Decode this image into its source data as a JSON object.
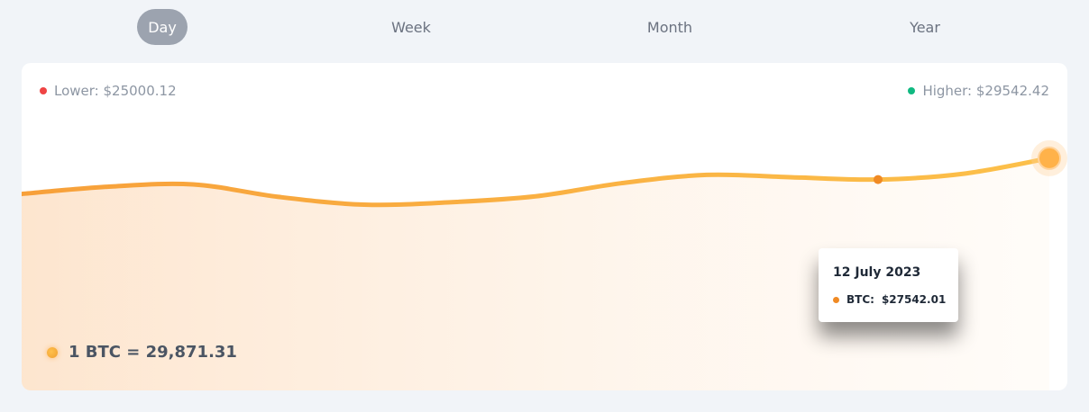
{
  "tabs": [
    {
      "label": "Day",
      "active": true
    },
    {
      "label": "Week",
      "active": false
    },
    {
      "label": "Month",
      "active": false
    },
    {
      "label": "Year",
      "active": false
    }
  ],
  "legend": {
    "lower": {
      "label": "Lower: $25000.12",
      "color": "#ef4444"
    },
    "higher": {
      "label": "Higher: $29542.42",
      "color": "#10b981"
    }
  },
  "rate_text": "1 BTC = 29,871.31",
  "tooltip": {
    "date": "12 July 2023",
    "series_label": "BTC:",
    "value": "$27542.01"
  },
  "colors": {
    "line_start": "#f7a03a",
    "line_end": "#fcc04a",
    "area": "#fde4cc",
    "marker": "#f08a24"
  },
  "chart_data": {
    "type": "area",
    "x": [
      0,
      1,
      2,
      3,
      4,
      5,
      6,
      7,
      8,
      9,
      10,
      11,
      12
    ],
    "series": [
      {
        "values": [
          27300,
          27420,
          27460,
          27250,
          27120,
          27160,
          27260,
          27480,
          27620,
          27580,
          27542.01,
          27640,
          27900
        ]
      }
    ],
    "highlight_index": 10,
    "ylim": [
      24000,
      29500
    ],
    "grid": false
  }
}
